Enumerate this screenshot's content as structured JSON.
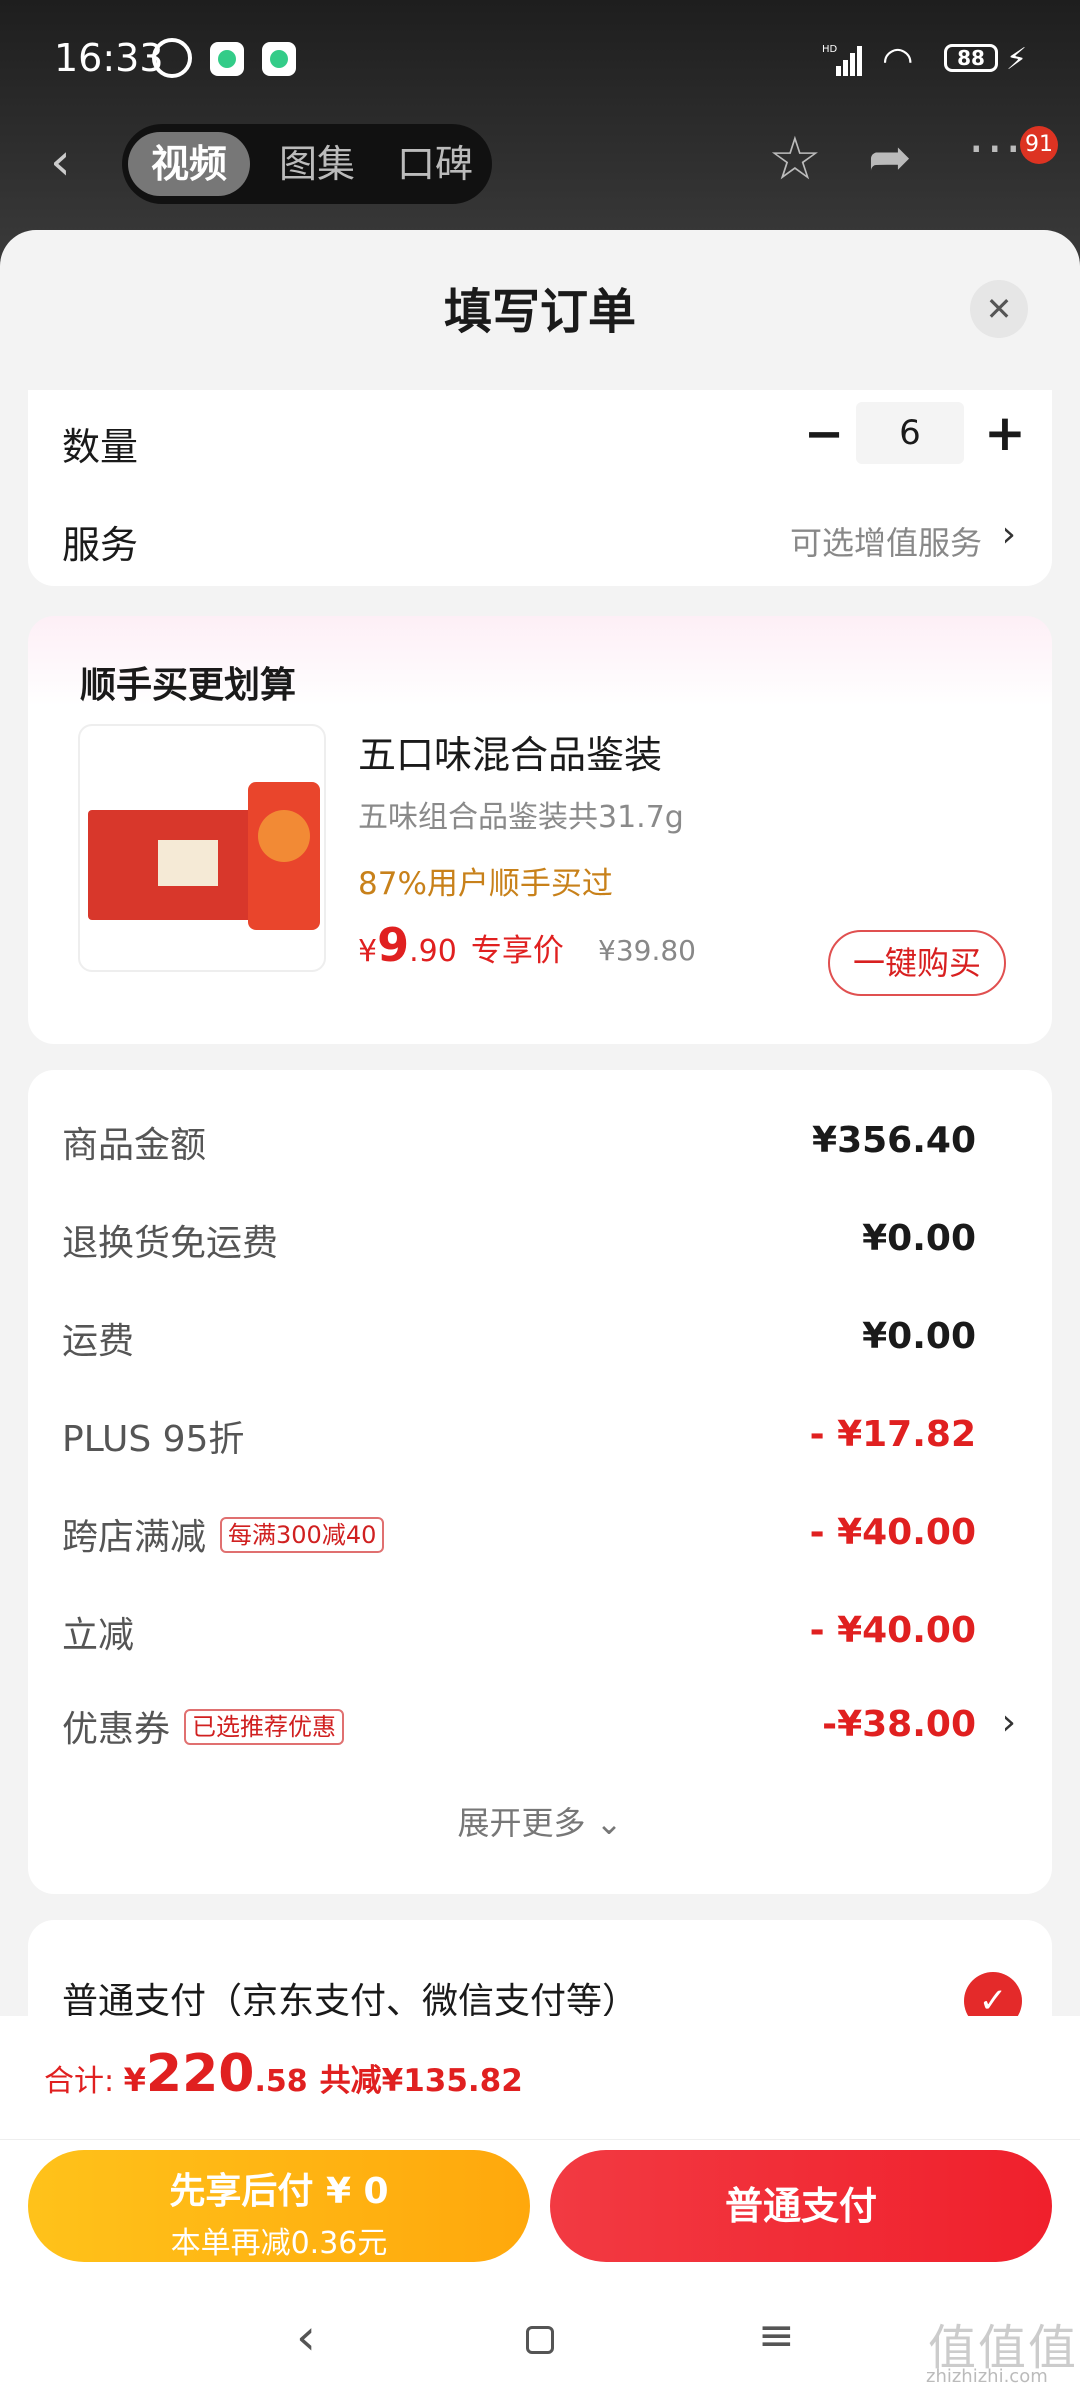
{
  "status_bar": {
    "time": "16:33",
    "network": "HD",
    "battery": "88"
  },
  "header": {
    "tabs": [
      {
        "label": "视频"
      },
      {
        "label": "图集"
      },
      {
        "label": "口碑"
      }
    ],
    "badge": "91"
  },
  "sheet": {
    "title": "填写订单"
  },
  "order": {
    "quantity_label": "数量",
    "quantity": "6",
    "service_label": "服务",
    "service_value": "可选增值服务"
  },
  "upsell": {
    "heading": "顺手买更划算",
    "name": "五口味混合品鉴装",
    "desc": "五味组合品鉴装共31.7g",
    "rate": "87%用户顺手买过",
    "price_symbol": "¥",
    "price_int": "9",
    "price_dec": ".90",
    "price_tag": "专享价",
    "orig_price": "¥39.80",
    "buy_label": "一键购买"
  },
  "price_rows": [
    {
      "label": "商品金额",
      "value": "¥356.40",
      "pill": ""
    },
    {
      "label": "退换货免运费",
      "value": "¥0.00",
      "pill": ""
    },
    {
      "label": "运费",
      "value": "¥0.00",
      "pill": ""
    },
    {
      "label": "PLUS 95折",
      "value": "- ¥17.82",
      "pill": ""
    },
    {
      "label": "跨店满减",
      "value": "- ¥40.00",
      "pill": "每满300减40"
    },
    {
      "label": "立减",
      "value": "- ¥40.00",
      "pill": ""
    },
    {
      "label": "优惠券",
      "value": "-¥38.00",
      "pill": "已选推荐优惠"
    }
  ],
  "expand_label": "展开更多 ⌄",
  "payment": {
    "label": "普通支付（京东支付、微信支付等）"
  },
  "footer": {
    "total_label": "合计: ",
    "total_symbol": "¥",
    "total_int": "220",
    "total_dec": ".58",
    "saved": "共减¥135.82",
    "later_line1": "先享后付 ¥ 0",
    "later_line2": "本单再减0.36元",
    "pay_label": "普通支付"
  },
  "watermark": {
    "glyphs": "值值值",
    "domain": "zhizhizhi.com"
  },
  "colors": {
    "accent": "#e02020",
    "orange": "#c8811a",
    "later_button": "#ffb40f"
  }
}
